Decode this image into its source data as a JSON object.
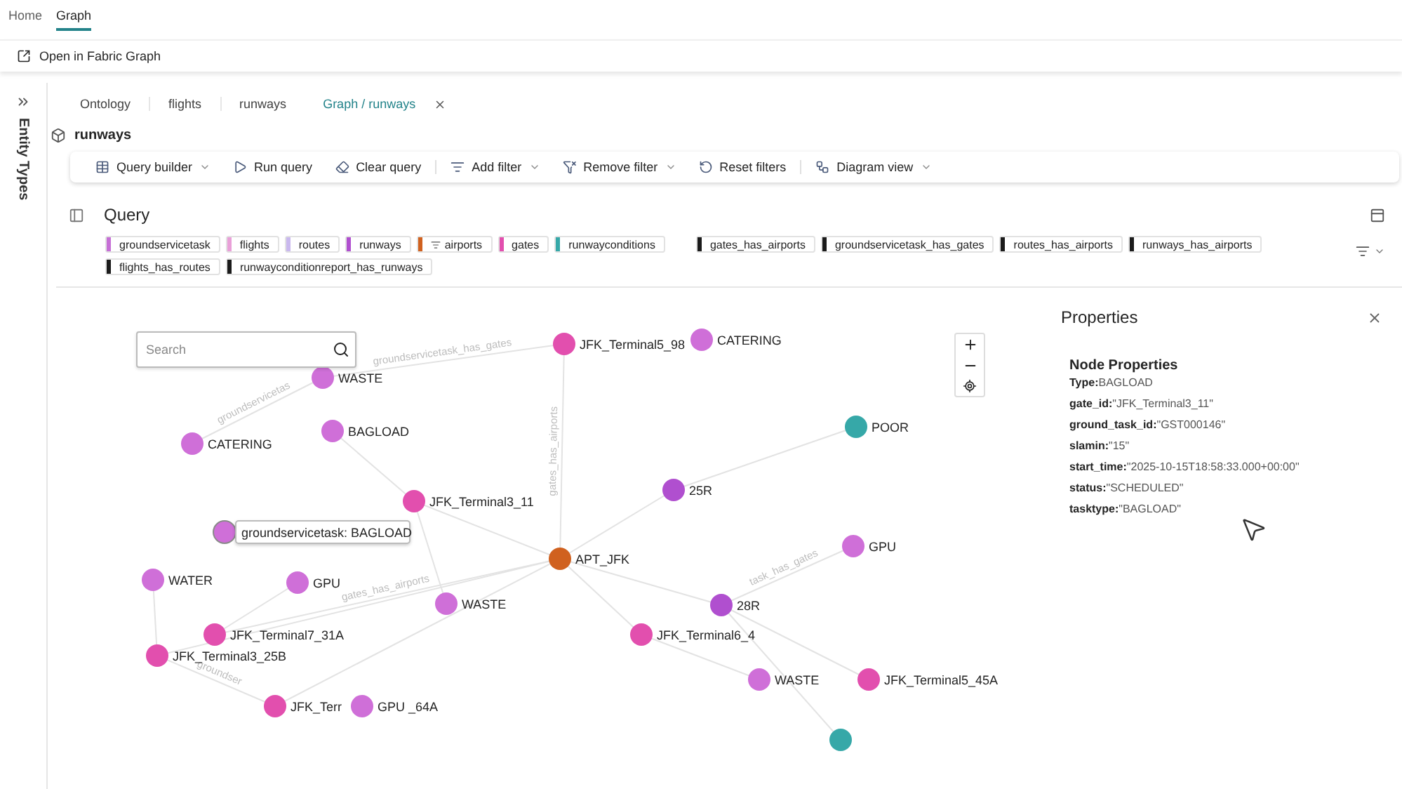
{
  "top_tabs": [
    {
      "label": "Home",
      "selected": false
    },
    {
      "label": "Graph",
      "selected": true
    }
  ],
  "ribbon": {
    "action": "Open in Fabric Graph"
  },
  "side_rail": {
    "title": "Entity Types"
  },
  "doc_tabs": [
    {
      "label": "Ontology",
      "selected": false,
      "closable": false
    },
    {
      "label": "flights",
      "selected": false,
      "closable": false
    },
    {
      "label": "runways",
      "selected": false,
      "closable": false
    },
    {
      "label": "Graph / runways",
      "selected": true,
      "closable": true
    }
  ],
  "page_title": "runways",
  "toolbar": [
    [
      {
        "label": "Query builder",
        "dropdown": true
      },
      {
        "label": "Run query",
        "dropdown": false
      },
      {
        "label": "Clear query",
        "dropdown": false
      }
    ],
    [
      {
        "label": "Add filter",
        "dropdown": true
      },
      {
        "label": "Remove filter",
        "dropdown": true
      },
      {
        "label": "Reset filters",
        "dropdown": false
      }
    ],
    [
      {
        "label": "Diagram view",
        "dropdown": true
      }
    ]
  ],
  "query": {
    "title": "Query",
    "node_types": [
      {
        "label": "groundservicetask",
        "color": "#c66fd6",
        "filtered": false
      },
      {
        "label": "flights",
        "color": "#e9a0d8",
        "filtered": false
      },
      {
        "label": "routes",
        "color": "#c9b8ee",
        "filtered": false
      },
      {
        "label": "runways",
        "color": "#b04fcf",
        "filtered": false
      },
      {
        "label": "airports",
        "color": "#d0611f",
        "filtered": true
      },
      {
        "label": "gates",
        "color": "#e24fae",
        "filtered": false
      },
      {
        "label": "runwayconditions",
        "color": "#36a8a8",
        "filtered": false
      }
    ],
    "edge_types": [
      {
        "label": "gates_has_airports"
      },
      {
        "label": "groundservicetask_has_gates"
      },
      {
        "label": "routes_has_airports"
      },
      {
        "label": "runways_has_airports"
      },
      {
        "label": "flights_has_routes"
      },
      {
        "label": "runwayconditionreport_has_runways"
      }
    ]
  },
  "graph": {
    "search": {
      "placeholder": "Search"
    },
    "nodes": [
      {
        "label": "JFK_Terminal5_98",
        "color": "#e24fae",
        "hovered": false
      },
      {
        "label": "CATERING",
        "color": "#cf6fd8",
        "hovered": false
      },
      {
        "label": "WASTE",
        "color": "#cf6fd8",
        "hovered": false
      },
      {
        "label": "BAGLOAD",
        "color": "#cf6fd8",
        "hovered": false
      },
      {
        "label": "CATERING",
        "color": "#cf6fd8",
        "hovered": false
      },
      {
        "label": "POOR",
        "color": "#36a8a8",
        "hovered": false
      },
      {
        "label": "JFK_Terminal3_11",
        "color": "#e24fae",
        "hovered": false
      },
      {
        "label": "25R",
        "color": "#b04fcf",
        "hovered": false
      },
      {
        "label": "groundservicetask: BAGLOAD",
        "color": "#cf6fd8",
        "hovered": true
      },
      {
        "label": "APT_JFK",
        "color": "#d0611f",
        "hovered": false
      },
      {
        "label": "GPU",
        "color": "#cf6fd8",
        "hovered": false
      },
      {
        "label": "WATER",
        "color": "#cf6fd8",
        "hovered": false
      },
      {
        "label": "GPU",
        "color": "#cf6fd8",
        "hovered": false
      },
      {
        "label": "WASTE",
        "color": "#cf6fd8",
        "hovered": false
      },
      {
        "label": "28R",
        "color": "#b04fcf",
        "hovered": false
      },
      {
        "label": "JFK_Terminal7_31A",
        "color": "#e24fae",
        "hovered": false
      },
      {
        "label": "JFK_Terminal6_4",
        "color": "#e24fae",
        "hovered": false
      },
      {
        "label": "JFK_Terminal3_25B",
        "color": "#e24fae",
        "hovered": false
      },
      {
        "label": "WASTE",
        "color": "#cf6fd8",
        "hovered": false
      },
      {
        "label": "JFK_Terminal5_45A",
        "color": "#e24fae",
        "hovered": false
      },
      {
        "label": "JFK_Terr",
        "color": "#e24fae",
        "hovered": false
      },
      {
        "label": "GPU _64A",
        "color": "#cf6fd8",
        "hovered": false
      },
      {
        "color": "#36a8a8",
        "hovered": false
      }
    ],
    "edge_labels": [
      "gates_has_airports",
      "groundservicetask_has_gates",
      "task_has_gates",
      "gates_has_airports",
      "groundservicetas",
      "groundser"
    ]
  },
  "properties": {
    "title": "Properties",
    "section": "Node Properties",
    "fields": [
      {
        "key": "Type:",
        "value": "BAGLOAD"
      },
      {
        "key": "gate_id:",
        "value": "\"JFK_Terminal3_11\""
      },
      {
        "key": "ground_task_id:",
        "value": "\"GST000146\""
      },
      {
        "key": "slamin:",
        "value": "\"15\""
      },
      {
        "key": "start_time:",
        "value": "\"2025-10-15T18:58:33.000+00:00\""
      },
      {
        "key": "status:",
        "value": "\"SCHEDULED\""
      },
      {
        "key": "tasktype:",
        "value": "\"BAGLOAD\""
      }
    ]
  }
}
